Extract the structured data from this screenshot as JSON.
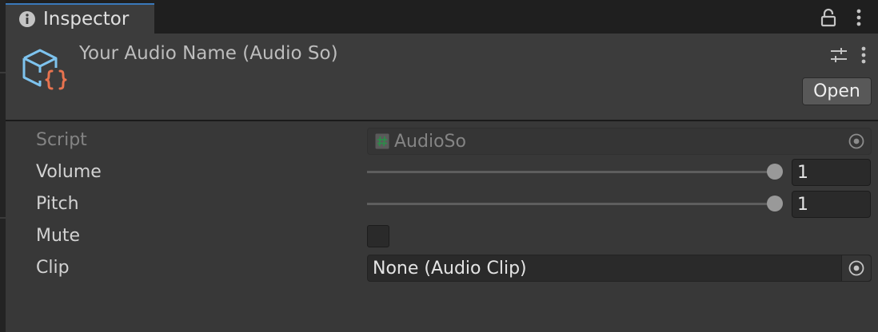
{
  "tab": {
    "label": "Inspector",
    "icon": "info-icon"
  },
  "header": {
    "title": "Your Audio Name (Audio So)",
    "icon": "scriptable-object-icon",
    "open_label": "Open"
  },
  "properties": {
    "script": {
      "label": "Script",
      "value": "AudioSo",
      "icon": "csharp-script-icon"
    },
    "volume": {
      "label": "Volume",
      "value": "1",
      "slider_fraction": 1.0
    },
    "pitch": {
      "label": "Pitch",
      "value": "1",
      "slider_fraction": 1.0
    },
    "mute": {
      "label": "Mute",
      "checked": false
    },
    "clip": {
      "label": "Clip",
      "value": "None (Audio Clip)"
    }
  },
  "colors": {
    "accent": "#3a79bb",
    "icon_blue": "#7ec3ee",
    "icon_orange": "#e8734f"
  }
}
